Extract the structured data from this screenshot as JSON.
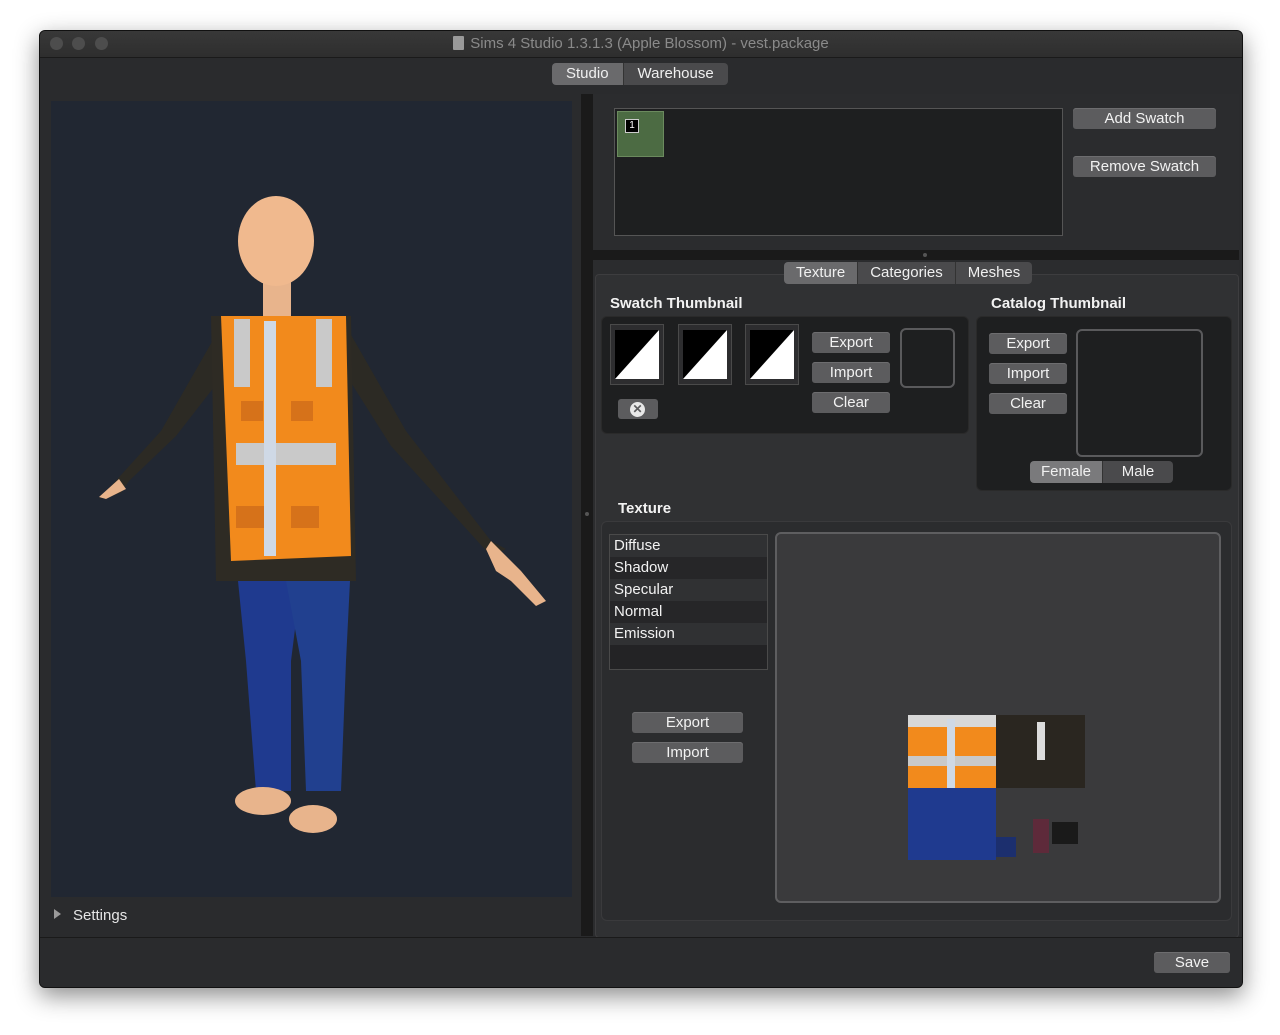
{
  "window": {
    "title": "Sims 4 Studio 1.3.1.3 (Apple Blossom)  - vest.package"
  },
  "top_tabs": [
    {
      "label": "Studio",
      "active": true
    },
    {
      "label": "Warehouse",
      "active": false
    }
  ],
  "left": {
    "settings_label": "Settings"
  },
  "swatches": {
    "items": [
      {
        "number": "1",
        "color": "#4c6b43"
      }
    ],
    "add_label": "Add Swatch",
    "remove_label": "Remove Swatch"
  },
  "sub_tabs": [
    {
      "label": "Texture",
      "active": true
    },
    {
      "label": "Categories",
      "active": false
    },
    {
      "label": "Meshes",
      "active": false
    }
  ],
  "swatch_thumbnail": {
    "title": "Swatch Thumbnail",
    "export_label": "Export",
    "import_label": "Import",
    "clear_label": "Clear"
  },
  "catalog_thumbnail": {
    "title": "Catalog Thumbnail",
    "export_label": "Export",
    "import_label": "Import",
    "clear_label": "Clear",
    "gender_options": [
      {
        "label": "Female",
        "active": true
      },
      {
        "label": "Male",
        "active": false
      }
    ]
  },
  "texture": {
    "title": "Texture",
    "channels": [
      "Diffuse",
      "Shadow",
      "Specular",
      "Normal",
      "Emission"
    ],
    "export_label": "Export",
    "import_label": "Import"
  },
  "footer": {
    "save_label": "Save"
  },
  "colors": {
    "accent_orange": "#f28a1c",
    "jeans_blue": "#1f3a8f",
    "viewport_bg": "#212732"
  }
}
